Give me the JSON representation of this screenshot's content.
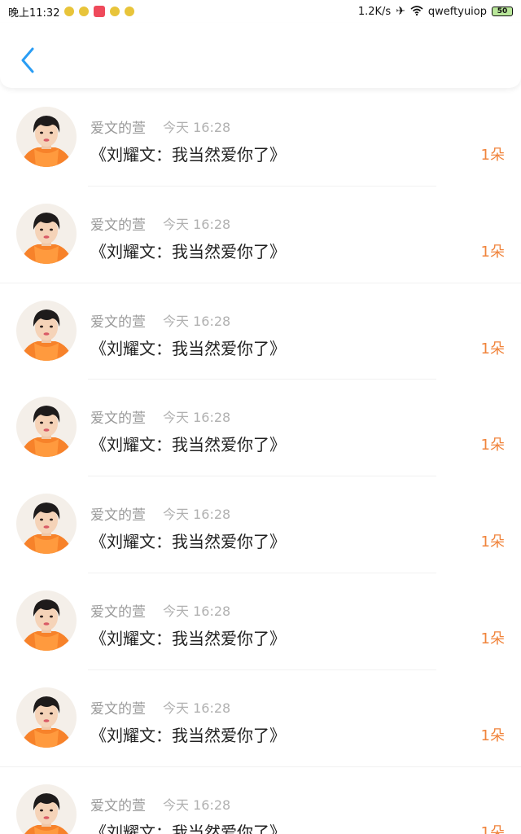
{
  "status_bar": {
    "time": "晚上11:32",
    "network_speed": "1.2K/s",
    "carrier": "qweftyuiop",
    "battery": "50"
  },
  "header": {
    "back_icon": "chevron-left-icon",
    "accent_color": "#2a9df4"
  },
  "colors": {
    "count": "#f0843c",
    "name": "#9a9a9a",
    "time": "#b1b1b1",
    "message": "#222222"
  },
  "messages": [
    {
      "name": "爱文的萱",
      "time": "今天 16:28",
      "text": "《刘耀文：我当然爱你了》",
      "count": "1朵"
    },
    {
      "name": "爱文的萱",
      "time": "今天 16:28",
      "text": "《刘耀文：我当然爱你了》",
      "count": "1朵"
    },
    {
      "name": "爱文的萱",
      "time": "今天 16:28",
      "text": "《刘耀文：我当然爱你了》",
      "count": "1朵"
    },
    {
      "name": "爱文的萱",
      "time": "今天 16:28",
      "text": "《刘耀文：我当然爱你了》",
      "count": "1朵"
    },
    {
      "name": "爱文的萱",
      "time": "今天 16:28",
      "text": "《刘耀文：我当然爱你了》",
      "count": "1朵"
    },
    {
      "name": "爱文的萱",
      "time": "今天 16:28",
      "text": "《刘耀文：我当然爱你了》",
      "count": "1朵"
    },
    {
      "name": "爱文的萱",
      "time": "今天 16:28",
      "text": "《刘耀文：我当然爱你了》",
      "count": "1朵"
    },
    {
      "name": "爱文的萱",
      "time": "今天 16:28",
      "text": "《刘耀文：我当然爱你了》",
      "count": "1朵"
    }
  ]
}
